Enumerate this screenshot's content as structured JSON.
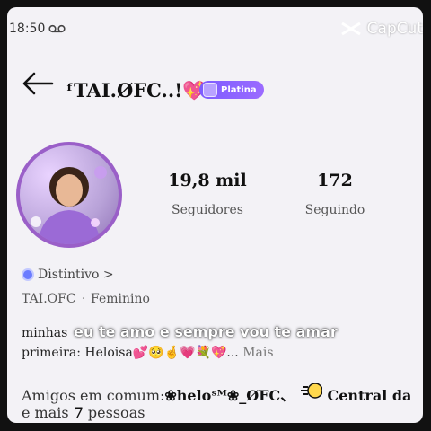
{
  "status": {
    "time": "18:50"
  },
  "watermark": {
    "label": "CapCut"
  },
  "profile": {
    "username": "ᶠTAI.ØFC..!💖",
    "badge": "Platina",
    "followers_count": "19,8 mil",
    "followers_label": "Seguidores",
    "following_count": "172",
    "following_label": "Seguindo",
    "distintivo": "Distintivo >",
    "handle": "TAI.OFC",
    "gender": "Feminino",
    "bio_line1": "minhas",
    "bio_line2": "primeira: Heloisa💕🥺🤞💗💐💖...",
    "bio_more": "Mais"
  },
  "caption": "eu te amo e sempre vou te amar",
  "mutual": {
    "prefix": "Amigos em comum:",
    "friend1": "❀heloˢᴹ❀_ØFC、",
    "friend2": "Central da",
    "more_prefix": "e mais",
    "more_count": "7",
    "more_suffix": "pessoas"
  },
  "colors": {
    "badge": "#8a63ff",
    "avatar_ring": "#9a5fc8",
    "background": "#f3f2f6"
  }
}
